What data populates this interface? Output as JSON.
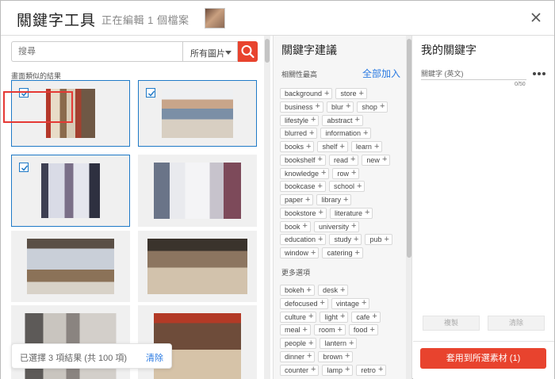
{
  "header": {
    "title": "關鍵字工具",
    "subtitle": "正在編輯 1 個檔案"
  },
  "search": {
    "placeholder": "搜尋",
    "filter": "所有圖片"
  },
  "results": {
    "similar_label": "畫面類似的結果",
    "selection_text": "已選擇 3 項結果 (共 100 項)",
    "clear": "清除"
  },
  "suggestions": {
    "title": "關鍵字建議",
    "relevance_label": "相關性最高",
    "add_all": "全部加入",
    "top_rows": [
      [
        "background",
        "store"
      ],
      [
        "business",
        "blur",
        "shop"
      ],
      [
        "lifestyle",
        "abstract"
      ],
      [
        "blurred",
        "information"
      ],
      [
        "books",
        "shelf",
        "learn"
      ],
      [
        "bookshelf",
        "read",
        "new"
      ],
      [
        "knowledge",
        "row"
      ],
      [
        "bookcase",
        "school"
      ],
      [
        "paper",
        "library"
      ],
      [
        "bookstore",
        "literature"
      ],
      [
        "book",
        "university"
      ],
      [
        "education",
        "study",
        "pub"
      ],
      [
        "window",
        "catering"
      ]
    ],
    "more_label": "更多選項",
    "more_rows": [
      [
        "bokeh",
        "desk"
      ],
      [
        "defocused",
        "vintage"
      ],
      [
        "culture",
        "light",
        "cafe"
      ],
      [
        "meal",
        "room",
        "food"
      ],
      [
        "people",
        "lantern"
      ],
      [
        "dinner",
        "brown"
      ],
      [
        "counter",
        "lamp",
        "retro"
      ]
    ]
  },
  "my_keywords": {
    "title": "我的關鍵字",
    "field_label": "關鍵字 (英文)",
    "count": "0/50",
    "copy": "複製",
    "empty": "清除",
    "apply": "套用到所選素材 (1)"
  },
  "colors": {
    "accent": "#e8432e",
    "link": "#2a7ae2",
    "selected_border": "#1f7ac7"
  }
}
